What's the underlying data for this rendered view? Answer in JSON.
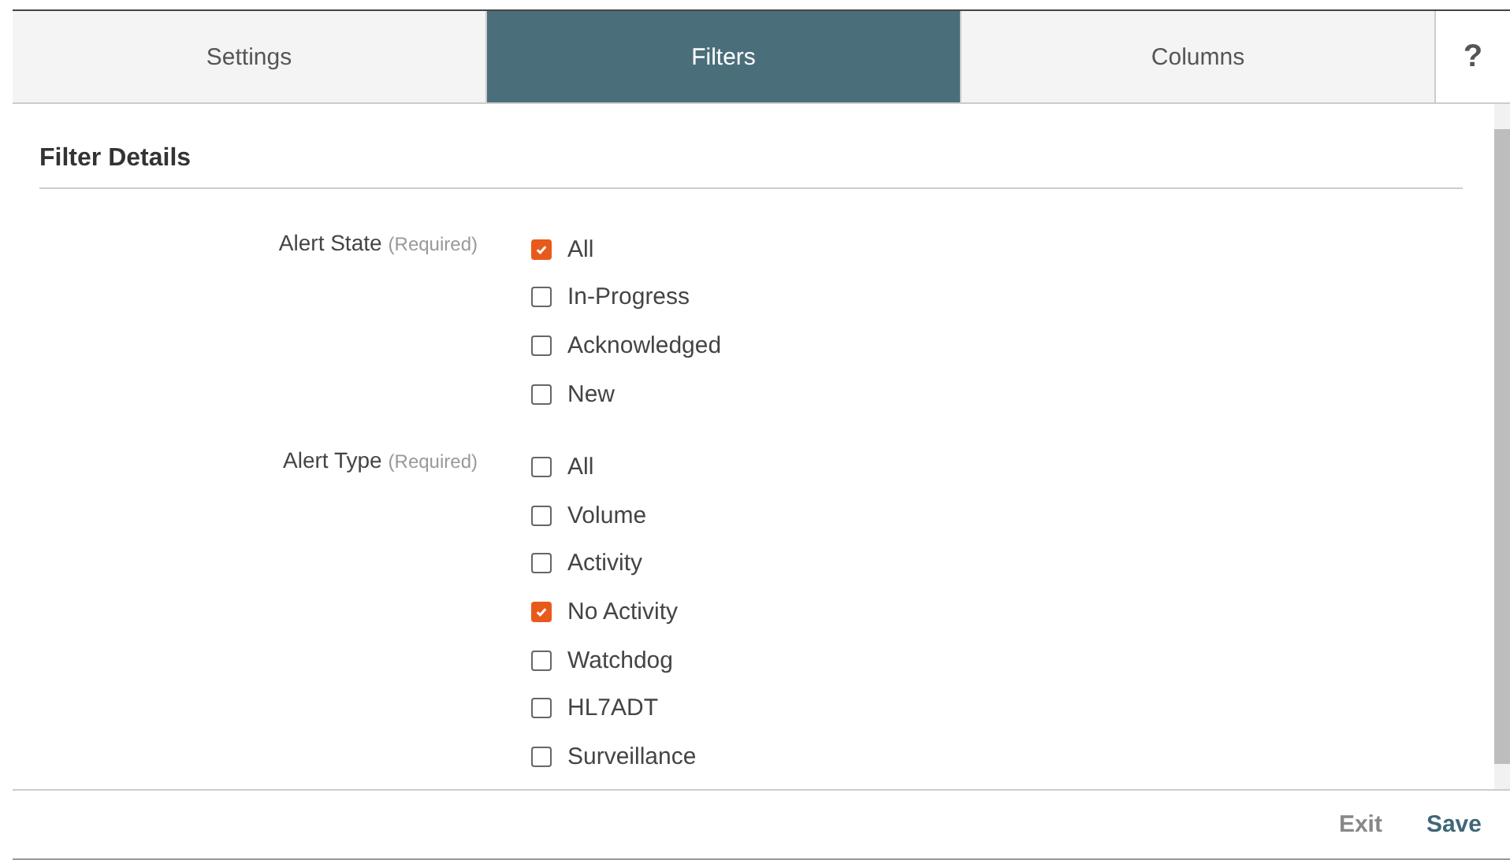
{
  "tabs": [
    {
      "label": "Settings",
      "selected": false
    },
    {
      "label": "Filters",
      "selected": true
    },
    {
      "label": "Columns",
      "selected": false
    }
  ],
  "help_button": "?",
  "section_title": "Filter Details",
  "groups": [
    {
      "label": "Alert State",
      "note": "(Required)",
      "options": [
        {
          "label": "All",
          "checked": true
        },
        {
          "label": "In-Progress",
          "checked": false
        },
        {
          "label": "Acknowledged",
          "checked": false
        },
        {
          "label": "New",
          "checked": false
        }
      ]
    },
    {
      "label": "Alert Type",
      "note": "(Required)",
      "options": [
        {
          "label": "All",
          "checked": false
        },
        {
          "label": "Volume",
          "checked": false
        },
        {
          "label": "Activity",
          "checked": false
        },
        {
          "label": "No Activity",
          "checked": true
        },
        {
          "label": "Watchdog",
          "checked": false
        },
        {
          "label": "HL7ADT",
          "checked": false
        },
        {
          "label": "Surveillance",
          "checked": false
        }
      ]
    }
  ],
  "footer_buttons": [
    {
      "label": "Exit",
      "disabled": true
    },
    {
      "label": "Save",
      "disabled": false
    }
  ]
}
